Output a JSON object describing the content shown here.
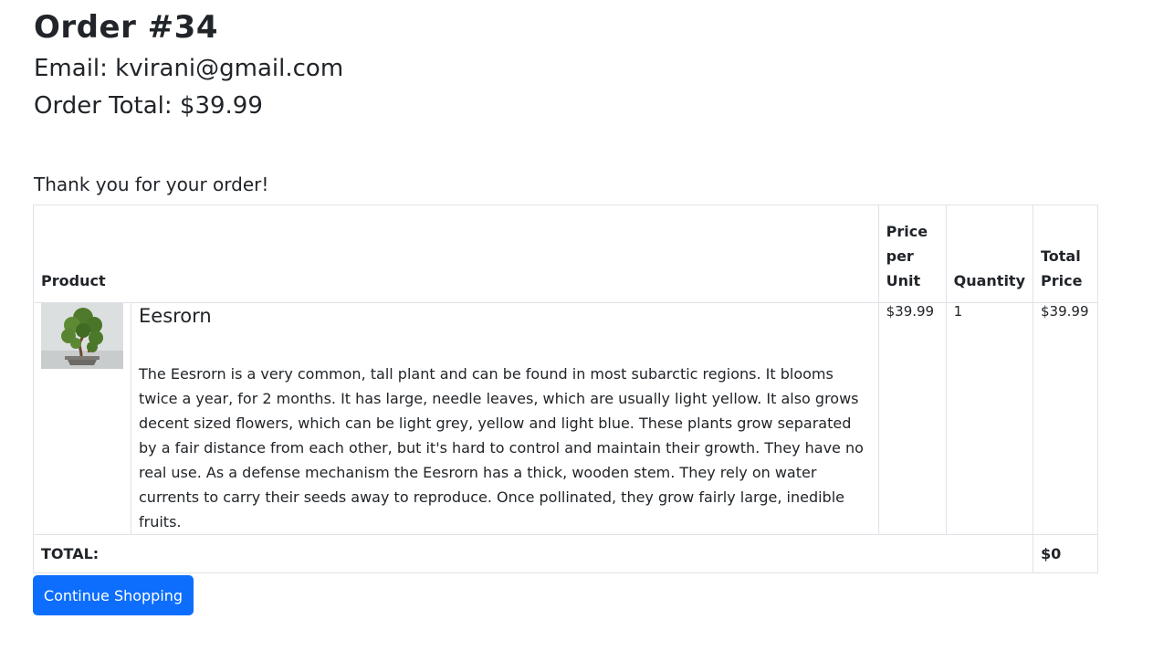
{
  "order": {
    "title": "Order #34",
    "email": "Email: kvirani@gmail.com",
    "total": "Order Total: $39.99",
    "thanks": "Thank you for your order!"
  },
  "table": {
    "headers": {
      "product": "Product",
      "price_per_unit": "Price per Unit",
      "quantity": "Quantity",
      "total_price": "Total Price"
    },
    "items": [
      {
        "image": "bonsai-tree-image",
        "name": "Eesrorn",
        "description": "The Eesrorn is a very common, tall plant and can be found in most subarctic regions. It blooms twice a year, for 2 months. It has large, needle leaves, which are usually light yellow. It also grows decent sized flowers, which can be light grey, yellow and light blue. These plants grow separated by a fair distance from each other, but it's hard to control and maintain their growth. They have no real use. As a defense mechanism the Eesrorn has a thick, wooden stem. They rely on water currents to carry their seeds away to reproduce. Once pollinated, they grow fairly large, inedible fruits.",
        "price": "$39.99",
        "quantity": "1",
        "total": "$39.99"
      }
    ],
    "footer": {
      "label": "TOTAL:",
      "value": "$0"
    }
  },
  "actions": {
    "continue_label": "Continue Shopping"
  },
  "colors": {
    "primary": "#0d6efd",
    "border": "#dee2e6",
    "text": "#212529"
  }
}
